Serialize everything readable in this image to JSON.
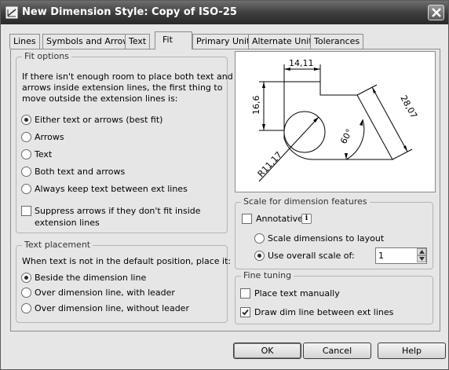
{
  "window": {
    "title": "New Dimension Style: Copy of ISO-25",
    "app_icon": "dimension-style-icon",
    "close_icon": "close-icon"
  },
  "tabs": [
    {
      "label": "Lines",
      "active": false
    },
    {
      "label": "Symbols and Arrows",
      "active": false
    },
    {
      "label": "Text",
      "active": false
    },
    {
      "label": "Fit",
      "active": true
    },
    {
      "label": "Primary Units",
      "active": false
    },
    {
      "label": "Alternate Units",
      "active": false
    },
    {
      "label": "Tolerances",
      "active": false
    }
  ],
  "fit_options": {
    "title": "Fit options",
    "description": [
      "If there isn't enough room to place both text and",
      "arrows inside extension lines, the first thing to",
      "move outside the extension lines is:"
    ],
    "options": [
      {
        "label": "Either text or arrows (best fit)",
        "selected": true
      },
      {
        "label": "Arrows",
        "selected": false
      },
      {
        "label": "Text",
        "selected": false
      },
      {
        "label": "Both text and arrows",
        "selected": false
      },
      {
        "label": "Always keep text between ext lines",
        "selected": false
      }
    ],
    "suppress": {
      "label_line1": "Suppress arrows if they don't fit inside",
      "label_line2": "extension lines",
      "checked": false
    }
  },
  "text_placement": {
    "title": "Text placement",
    "description": "When text is not in the default position, place it:",
    "options": [
      {
        "label": "Beside the dimension line",
        "selected": true
      },
      {
        "label": "Over dimension line, with leader",
        "selected": false
      },
      {
        "label": "Over dimension line, without leader",
        "selected": false
      }
    ]
  },
  "preview": {
    "dim_top": "14,11",
    "dim_left": "16,6",
    "dim_right": "28,07",
    "dim_angle": "60°",
    "dim_radius": "R11,17"
  },
  "scale": {
    "title": "Scale for dimension features",
    "annotative": {
      "label": "Annotative",
      "checked": false,
      "info_icon": "info-icon",
      "info_glyph": "i"
    },
    "options": [
      {
        "label": "Scale dimensions to layout",
        "selected": false
      },
      {
        "label": "Use overall scale of:",
        "selected": true
      }
    ],
    "overall_scale_value": "1"
  },
  "fine_tuning": {
    "title": "Fine tuning",
    "place_text_manually": {
      "label": "Place text manually",
      "checked": false
    },
    "draw_dim_line": {
      "label": "Draw dim line between ext lines",
      "checked": true
    }
  },
  "buttons": {
    "ok": "OK",
    "cancel": "Cancel",
    "help": "Help"
  }
}
